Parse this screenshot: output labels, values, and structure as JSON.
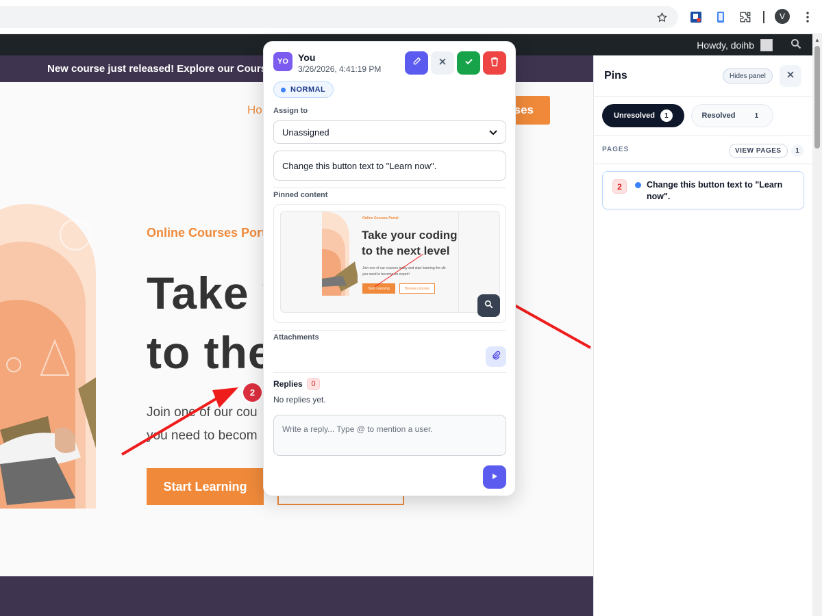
{
  "browser": {
    "icons": [
      "star-icon",
      "extension-1-icon",
      "extension-2-icon",
      "puzzle-icon",
      "more-vert-icon"
    ],
    "profile_initial": "V"
  },
  "adminbar": {
    "howdy": "Howdy, doihb"
  },
  "site": {
    "announcement": "New course just released! Explore our Courses",
    "nav_home": "Ho",
    "nav_cta": "rses",
    "eyebrow": "Online Courses Port",
    "headline_line1": "Take y",
    "headline_line2": "to the",
    "sub_line1": "Join one of our cou",
    "sub_line2": "you need to becom",
    "start_button": "Start Learning",
    "pin_marker": "2",
    "colors": {
      "accent": "#f08a3a",
      "dark": "#3f3450"
    }
  },
  "popup": {
    "avatar": "YO",
    "author": "You",
    "date": "3/26/2026, 4:41:19 PM",
    "priority": "NORMAL",
    "assign_label": "Assign to",
    "assign_value": "Unassigned",
    "comment": "Change this button text to \"Learn now\".",
    "pinned_label": "Pinned content",
    "preview": {
      "eyebrow": "Online Courses Portal",
      "headline1": "Take your coding",
      "headline2": "to the next level",
      "sub1": "Join one of our courses today and start learning the ski",
      "sub2": "you need to become an expert!",
      "btn1": "Start Learning",
      "btn2": "Browse courses"
    },
    "attachments_label": "Attachments",
    "replies_label": "Replies",
    "replies_count": "0",
    "no_replies": "No replies yet.",
    "reply_placeholder": "Write a reply... Type @ to mention a user."
  },
  "panel": {
    "title": "Pins",
    "hide_label": "Hides panel",
    "tab_unresolved": "Unresolved",
    "tab_unresolved_count": "1",
    "tab_resolved": "Resolved",
    "tab_resolved_count": "1",
    "pages_label": "PAGES",
    "view_pages": "VIEW PAGES",
    "pages_count": "1",
    "pin_number": "2",
    "pin_text": "Change this button text to \"Learn now\"."
  }
}
